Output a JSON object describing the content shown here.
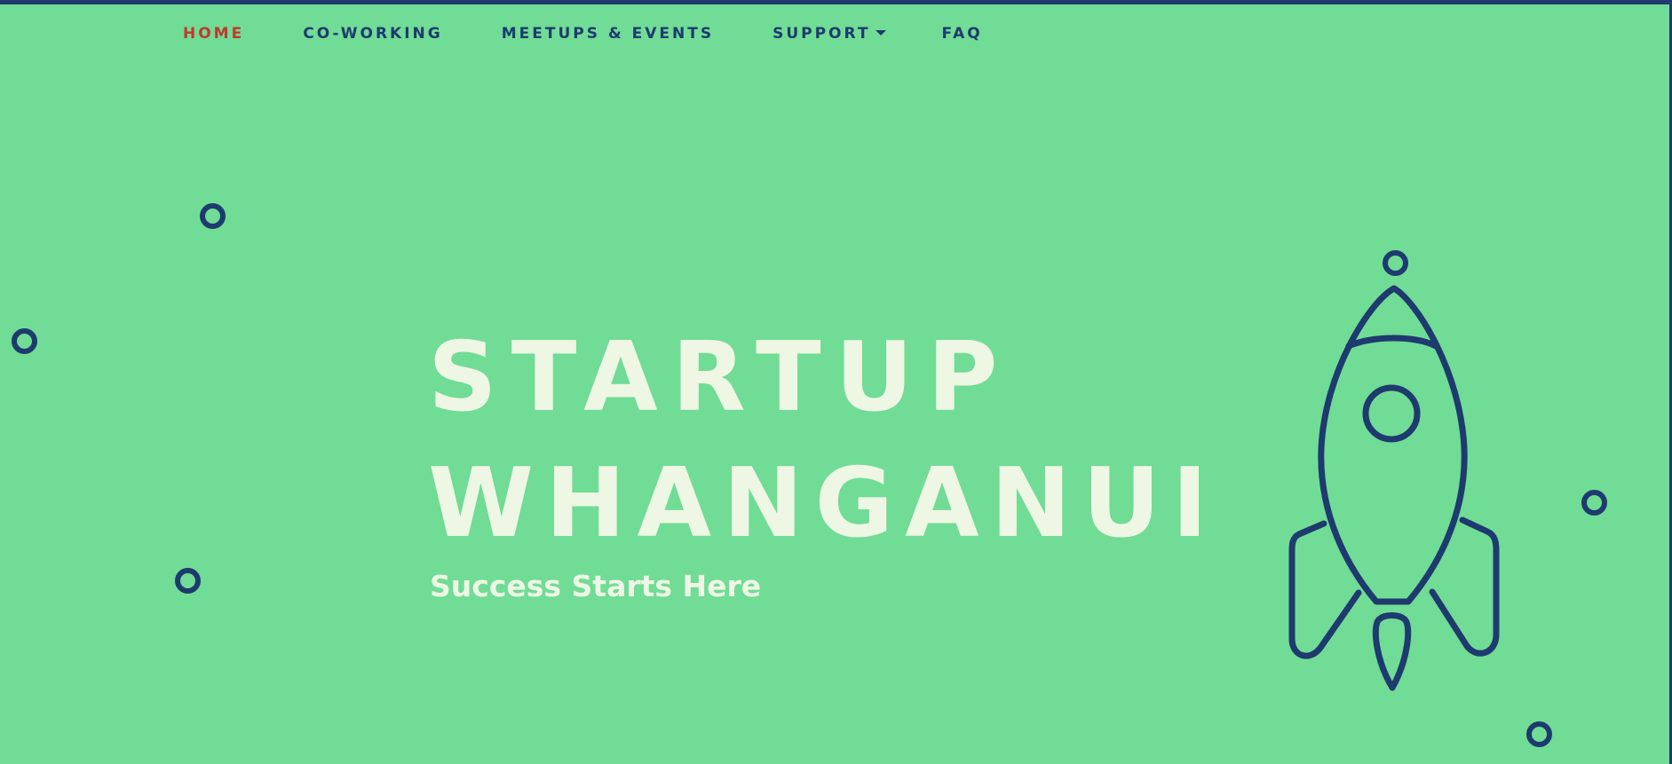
{
  "nav": {
    "items": [
      {
        "label": "HOME",
        "active": true
      },
      {
        "label": "CO-WORKING",
        "active": false
      },
      {
        "label": "MEETUPS & EVENTS",
        "active": false
      },
      {
        "label": "SUPPORT",
        "active": false,
        "has_dropdown": true
      },
      {
        "label": "FAQ",
        "active": false
      }
    ]
  },
  "hero": {
    "title_line1": "STARTUP",
    "title_line2": "WHANGANUI",
    "subtitle": "Success Starts Here"
  },
  "icons": {
    "rocket": "rocket-icon",
    "dropdown": "caret-down-icon",
    "decor": "ring-icon"
  },
  "colors": {
    "background": "#70DC95",
    "nav_text": "#1E3A6E",
    "nav_active": "#C0392B",
    "hero_text": "#EEF6E4",
    "outline": "#1E3A6E"
  }
}
